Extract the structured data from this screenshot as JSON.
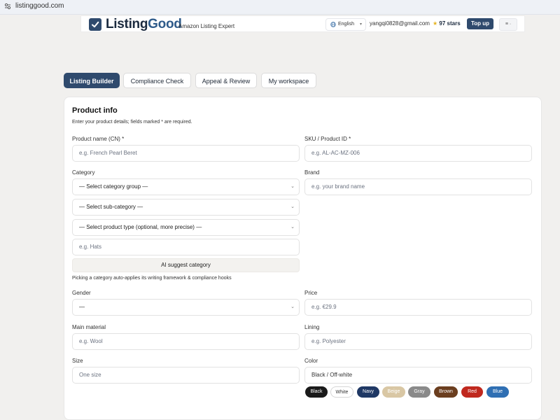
{
  "browser": {
    "url": "listinggood.com"
  },
  "header": {
    "logo_main": "Listing",
    "logo_accent": "Good",
    "tagline": "Amazon Listing Expert",
    "language": "English",
    "email": "yangqi0828@gmail.com",
    "stars": "97 stars",
    "topup_label": "Top up",
    "menu_label": "≡ ·"
  },
  "tabs": [
    {
      "label": "Listing Builder",
      "active": true
    },
    {
      "label": "Compliance Check",
      "active": false
    },
    {
      "label": "Appeal & Review",
      "active": false
    },
    {
      "label": "My workspace",
      "active": false
    }
  ],
  "form": {
    "title": "Product info",
    "hint": "Enter your product details; fields marked * are required.",
    "product_name": {
      "label": "Product name (CN) *",
      "placeholder": "e.g. French Pearl Beret"
    },
    "sku": {
      "label": "SKU / Product ID *",
      "placeholder": "e.g. AL-AC-MZ-006"
    },
    "category": {
      "label": "Category",
      "group": "— Select category group —",
      "sub": "— Select sub-category —",
      "type": "— Select product type (optional, more precise) —",
      "freeform_placeholder": "e.g. Hats",
      "ai_button": "AI suggest category",
      "note": "Picking a category auto-applies its writing framework & compliance hooks"
    },
    "brand": {
      "label": "Brand",
      "placeholder": "e.g. your brand name"
    },
    "gender": {
      "label": "Gender",
      "value": "—"
    },
    "price": {
      "label": "Price",
      "placeholder": "e.g. €29.9"
    },
    "main_material": {
      "label": "Main material",
      "placeholder": "e.g. Wool"
    },
    "lining": {
      "label": "Lining",
      "placeholder": "e.g. Polyester"
    },
    "size": {
      "label": "Size",
      "placeholder": "One size"
    },
    "color": {
      "label": "Color",
      "placeholder": "Black / Off-white"
    },
    "color_chips": [
      {
        "label": "Black",
        "bg": "#1a1a1a",
        "fg": "#ffffff"
      },
      {
        "label": "White",
        "bg": "#ffffff",
        "fg": "#333333"
      },
      {
        "label": "Navy",
        "bg": "#1f3864",
        "fg": "#ffffff"
      },
      {
        "label": "Beige",
        "bg": "#d9c7a4",
        "fg": "#ffffff"
      },
      {
        "label": "Gray",
        "bg": "#8a8a8a",
        "fg": "#ffffff"
      },
      {
        "label": "Brown",
        "bg": "#6b3e1f",
        "fg": "#ffffff"
      },
      {
        "label": "Red",
        "bg": "#c0281e",
        "fg": "#ffffff"
      },
      {
        "label": "Blue",
        "bg": "#2f6fb3",
        "fg": "#ffffff"
      }
    ]
  },
  "colors": {
    "brand": "#2f4a6d",
    "page_bg": "#f1f0ee"
  }
}
